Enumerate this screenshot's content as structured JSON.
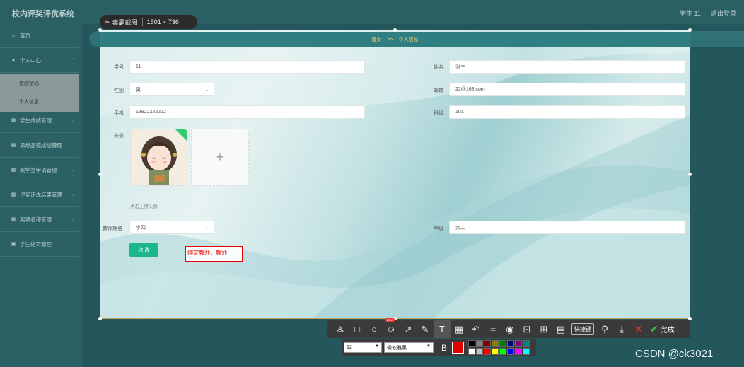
{
  "app": {
    "title": "校内评奖评优系统",
    "user": "学生 11",
    "logout": "退出登录"
  },
  "sidebar": {
    "items": [
      {
        "label": "首页",
        "icon": "home-icon"
      },
      {
        "label": "个人中心",
        "icon": "user-icon"
      },
      {
        "label": "学生成绩管理",
        "icon": "grid-icon"
      },
      {
        "label": "思想品德成绩管理",
        "icon": "grid-icon"
      },
      {
        "label": "奖学金申请管理",
        "icon": "grid-icon"
      },
      {
        "label": "评奖评优结果管理",
        "icon": "grid-icon"
      },
      {
        "label": "奖项名称管理",
        "icon": "grid-icon"
      },
      {
        "label": "学生处罚管理",
        "icon": "lock-icon"
      }
    ],
    "sub_items": [
      "修改密码",
      "个人信息"
    ]
  },
  "breadcrumb": {
    "home": "首页",
    "sep": ">>",
    "current": "个人信息"
  },
  "form": {
    "student_no": {
      "label": "学号",
      "value": "11"
    },
    "name": {
      "label": "姓名",
      "value": "张三"
    },
    "gender": {
      "label": "性别",
      "value": "男"
    },
    "email": {
      "label": "邮箱",
      "value": "22@163.com"
    },
    "phone": {
      "label": "手机",
      "value": "13922222222"
    },
    "class": {
      "label": "班级",
      "value": "101"
    },
    "avatar": {
      "label": "头像",
      "hint": "点击上传头像",
      "plus": "+"
    },
    "teacher": {
      "label": "教师姓名",
      "value": "李四"
    },
    "grade": {
      "label": "年级",
      "value": "大二"
    },
    "submit": "修 改"
  },
  "annotation": {
    "text": "绑定教师，教师"
  },
  "screenshot_tool": {
    "app_name": "毒霸截图",
    "size": "1501 × 736",
    "tools": [
      {
        "name": "shape-tool-icon",
        "glyph": "⟁"
      },
      {
        "name": "rectangle-tool-icon",
        "glyph": "□"
      },
      {
        "name": "ellipse-tool-icon",
        "glyph": "○"
      },
      {
        "name": "emoji-tool-icon",
        "glyph": "☺",
        "badge": "NEW"
      },
      {
        "name": "arrow-tool-icon",
        "glyph": "↗"
      },
      {
        "name": "pen-tool-icon",
        "glyph": "✎"
      },
      {
        "name": "text-tool-icon",
        "glyph": "T"
      },
      {
        "name": "mosaic-tool-icon",
        "glyph": "▦"
      },
      {
        "name": "undo-icon",
        "glyph": "↶"
      },
      {
        "name": "ocr-tool-icon",
        "glyph": "⌗"
      },
      {
        "name": "record-tool-icon",
        "glyph": "◉"
      },
      {
        "name": "scroll-capture-icon",
        "glyph": "⊡"
      },
      {
        "name": "add-capture-icon",
        "glyph": "⊞"
      },
      {
        "name": "comment-tool-icon",
        "glyph": "▤"
      }
    ],
    "shortcut": "快捷键",
    "pin_glyph": "⚲",
    "download_glyph": "⤓",
    "close_glyph": "✕",
    "done_glyph": "✔",
    "done": "完成",
    "font_size": "12",
    "font_name": "微软雅黑",
    "bold": "B",
    "current_color": "#e00000",
    "palette": [
      "#000000",
      "#808080",
      "#800000",
      "#808000",
      "#008000",
      "#000080",
      "#800080",
      "#008080",
      "#ffffff",
      "#c0c0c0",
      "#ff0000",
      "#ffff00",
      "#00ff00",
      "#0000ff",
      "#ff00ff",
      "#00ffff"
    ]
  },
  "watermark": "CSDN @ck3021"
}
